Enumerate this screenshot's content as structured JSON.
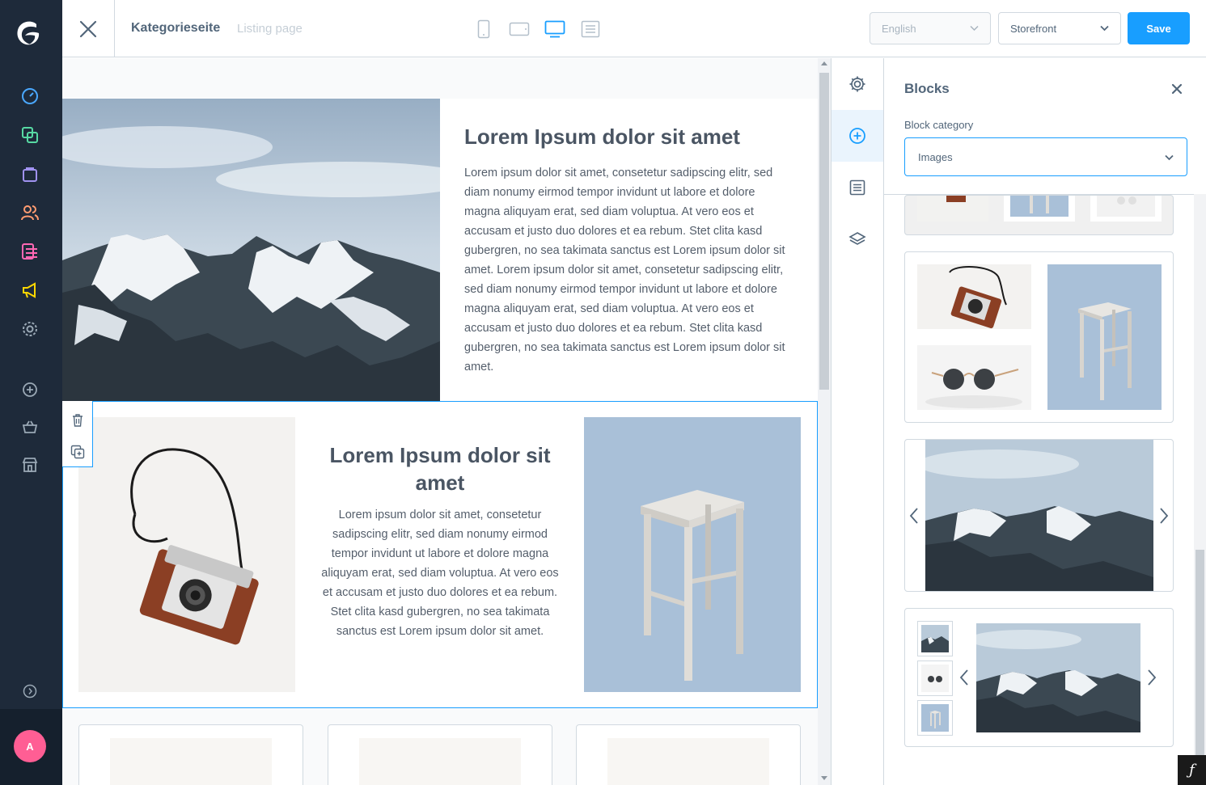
{
  "nav": {
    "logo": "shopware-logo",
    "items": [
      {
        "name": "dashboard-icon",
        "color": "#4aa8ff"
      },
      {
        "name": "catalogue-icon",
        "color": "#57d9a3"
      },
      {
        "name": "orders-icon",
        "color": "#a092f0"
      },
      {
        "name": "customers-icon",
        "color": "#ff9c71"
      },
      {
        "name": "content-icon",
        "color": "#ff68b4"
      },
      {
        "name": "marketing-icon",
        "color": "#ffd700"
      },
      {
        "name": "settings-icon",
        "color": "#9aa8b5"
      },
      {
        "name": "add-sales-channel-icon",
        "color": "#9aa8b5"
      },
      {
        "name": "shopping-basket-icon",
        "color": "#9aa8b5"
      },
      {
        "name": "storefront-icon",
        "color": "#9aa8b5"
      }
    ],
    "collapse_icon": "chevron-circle-right-icon",
    "avatar_initial": "A",
    "avatar_color": "#ff5e94"
  },
  "topbar": {
    "title": "Kategorieseite",
    "subtitle": "Listing page",
    "devices": [
      "mobile-icon",
      "tablet-landscape-icon",
      "desktop-icon",
      "form-icon"
    ],
    "active_device": "desktop-icon",
    "language": "English",
    "sales_channel": "Storefront",
    "save_label": "Save",
    "accent": "#189eff"
  },
  "canvas": {
    "block1": {
      "title": "Lorem Ipsum dolor sit amet",
      "body": "Lorem ipsum dolor sit amet, consetetur sadipscing elitr, sed diam nonumy eirmod tempor invidunt ut labore et dolore magna aliquyam erat, sed diam voluptua. At vero eos et accusam et justo duo dolores et ea rebum. Stet clita kasd gubergren, no sea takimata sanctus est Lorem ipsum dolor sit amet. Lorem ipsum dolor sit amet, consetetur sadipscing elitr, sed diam nonumy eirmod tempor invidunt ut labore et dolore magna aliquyam erat, sed diam voluptua. At vero eos et accusam et justo duo dolores et ea rebum. Stet clita kasd gubergren, no sea takimata sanctus est Lorem ipsum dolor sit amet."
    },
    "block2": {
      "title": "Lorem Ipsum dolor sit amet",
      "body": "Lorem ipsum dolor sit amet, consetetur sadipscing elitr, sed diam nonumy eirmod tempor invidunt ut labore et dolore magna aliquyam erat, sed diam voluptua. At vero eos et accusam et justo duo dolores et ea rebum. Stet clita kasd gubergren, no sea takimata sanctus est Lorem ipsum dolor sit amet.",
      "actions": [
        "trash-icon",
        "duplicate-icon"
      ]
    }
  },
  "sidebar": {
    "tabs": [
      "gear-icon",
      "plus-circle-icon",
      "list-icon",
      "layers-icon"
    ],
    "active_tab": "plus-circle-icon"
  },
  "blocks_panel": {
    "title": "Blocks",
    "category_label": "Block category",
    "category_value": "Images"
  }
}
